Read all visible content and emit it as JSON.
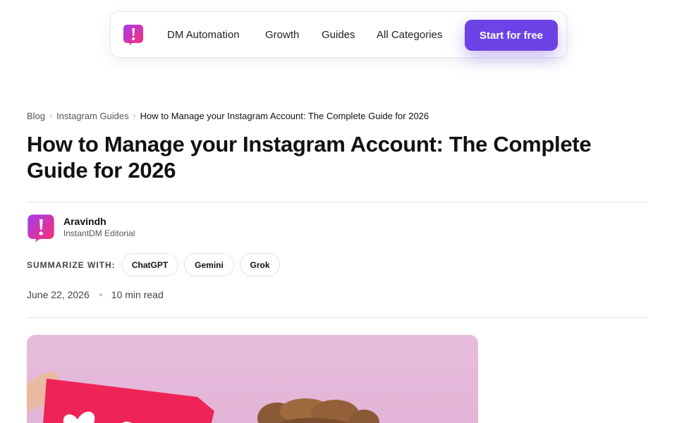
{
  "nav": {
    "logo_icon": "brand-exclamation-icon",
    "links": [
      "DM Automation",
      "Growth",
      "Guides",
      "All Categories"
    ],
    "cta_label": "Start for free",
    "cta_color": "#6e43e6"
  },
  "breadcrumb": {
    "items": [
      "Blog",
      "Instagram Guides"
    ],
    "current": "How to Manage your Instagram Account: The Complete Guide for 2026"
  },
  "article": {
    "title": "How to Manage your Instagram Account: The Complete Guide for 2026",
    "author": {
      "name": "Aravindh",
      "role": "InstantDM Editorial",
      "avatar_icon": "brand-exclamation-icon"
    },
    "summarize": {
      "label": "SUMMARIZE WITH:",
      "options": [
        "ChatGPT",
        "Gemini",
        "Grok"
      ]
    },
    "date": "June 22, 2026",
    "read_time": "10 min read",
    "hero_image": "instagram-hero-photo"
  },
  "colors": {
    "brand_gradient_start": "#a23df0",
    "brand_gradient_end": "#ff2e6e",
    "hero_bg": "#e7bddc"
  }
}
